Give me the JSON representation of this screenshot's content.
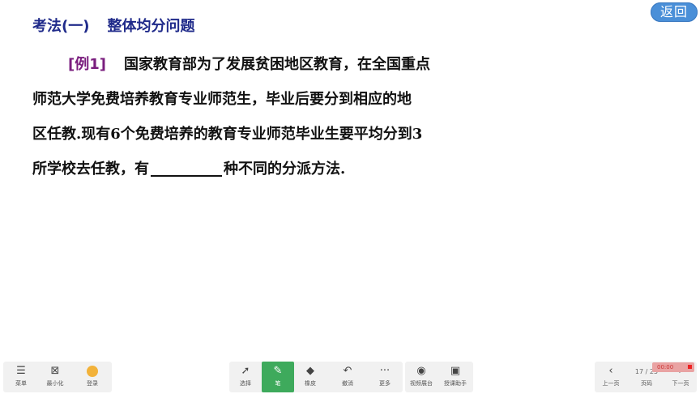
{
  "slide": {
    "title_part1": "考法(一)",
    "title_part2": "整体均分问题",
    "back_label": "返回",
    "example_tag": "[例1]",
    "lines": [
      "国家教育部为了发展贫困地区教育，在全国重点",
      "师范大学免费培养教育专业师范生，毕业后要分到相应的地",
      "区任教.现有6个免费培养的教育专业师范毕业生要平均分到3",
      "所学校去任教，有",
      "种不同的分派方法."
    ]
  },
  "toolbar": {
    "left": [
      {
        "label": "菜单",
        "icon": "menu-icon"
      },
      {
        "label": "最小化",
        "icon": "minimize-icon"
      },
      {
        "label": "登录",
        "icon": "avatar-icon"
      }
    ],
    "center": [
      {
        "label": "选择",
        "icon": "cursor-icon"
      },
      {
        "label": "笔",
        "icon": "pen-icon",
        "active": true
      },
      {
        "label": "橡皮",
        "icon": "eraser-icon"
      },
      {
        "label": "撤消",
        "icon": "undo-icon"
      },
      {
        "label": "更多",
        "icon": "more-icon"
      }
    ],
    "center2": [
      {
        "label": "视频展台",
        "icon": "camera-icon"
      },
      {
        "label": "授课助手",
        "icon": "assistant-icon"
      }
    ],
    "right": [
      {
        "label": "上一页",
        "icon": "prev-icon"
      },
      {
        "label": "页码",
        "icon": "page-icon"
      },
      {
        "label": "下一页",
        "icon": "next-icon"
      }
    ],
    "page_indicator": "17 / 25",
    "record_time": "00:00"
  },
  "colors": {
    "title": "#1f2a8a",
    "example_tag": "#7a1e7e",
    "back_button": "#4a8fd8",
    "active_tool": "#3eaa5c"
  }
}
